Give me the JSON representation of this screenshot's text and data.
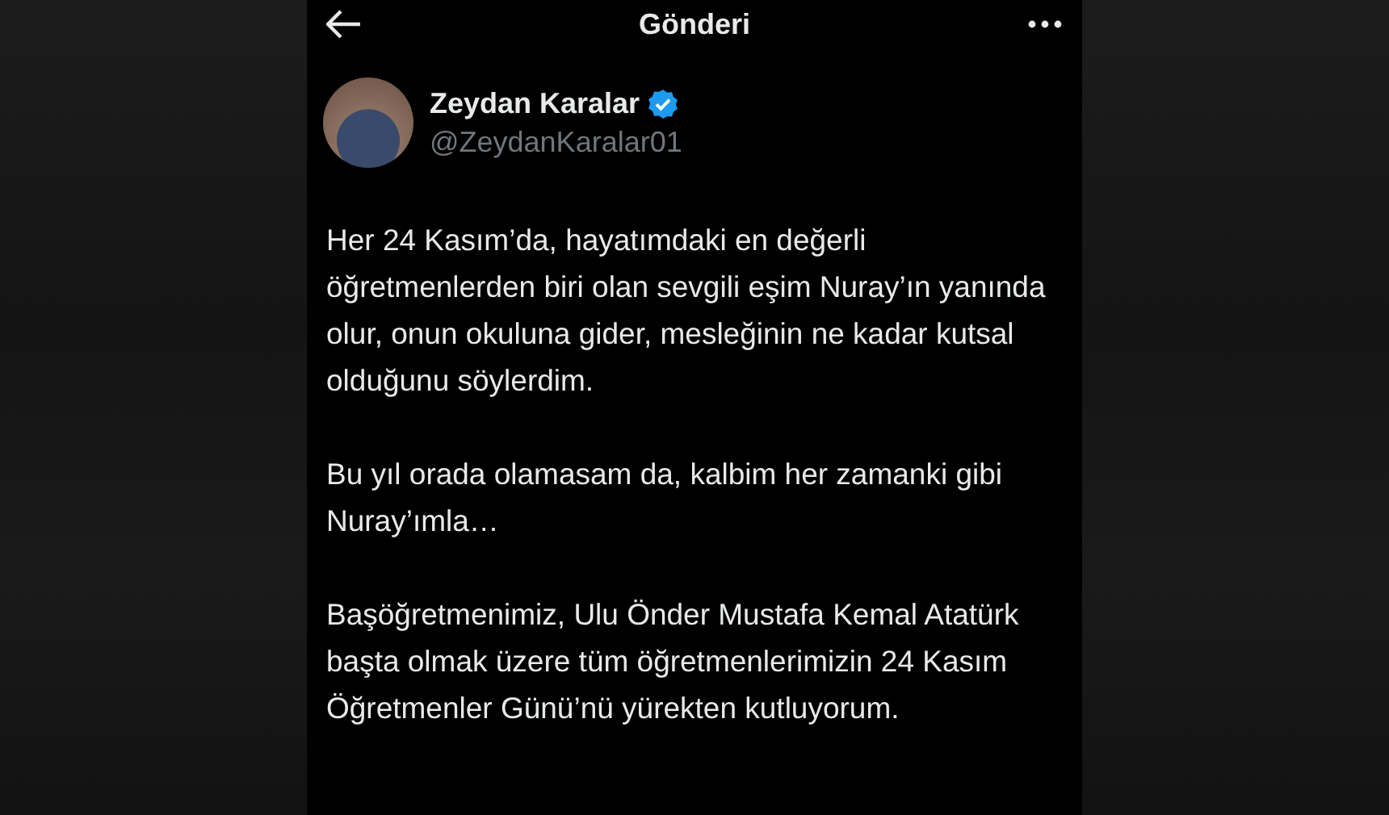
{
  "header": {
    "title": "Gönderi"
  },
  "author": {
    "name": "Zeydan Karalar",
    "verified": true,
    "handle": "@ZeydanKaralar01"
  },
  "paragraphs": [
    "Her 24 Kasım’da, hayatımdaki en değerli öğretmenlerden biri olan sevgili eşim Nuray’ın yanında olur, onun okuluna gider, mesleğinin ne kadar kutsal olduğunu söylerdim.",
    "Bu yıl orada olamasam da, kalbim her zamanki gibi Nuray’ımla…",
    "Başöğretmenimiz, Ulu Önder Mustafa Kemal Atatürk başta olmak üzere tüm öğretmenlerimizin 24 Kasım Öğretmenler Günü’nü yürekten kutluyorum."
  ]
}
